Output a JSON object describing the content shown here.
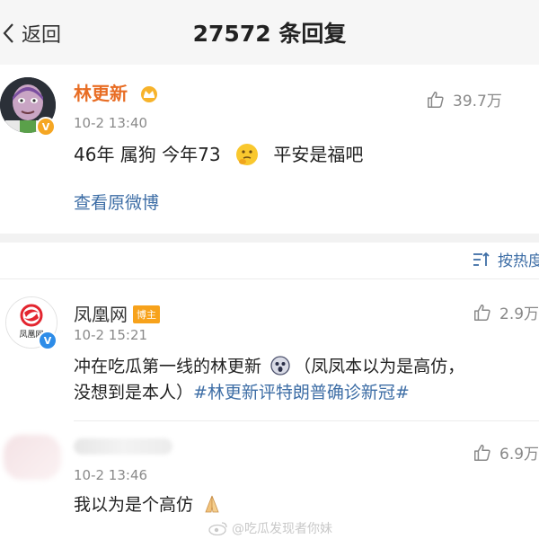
{
  "nav": {
    "back_label": "返回",
    "title_count": "27572",
    "title_suffix": " 条回复"
  },
  "original_post": {
    "author": "林更新",
    "time": "10-2 13:40",
    "likes": "39.7万",
    "text": "46年 属狗 今年73",
    "text_after_emoji": "平安是福吧",
    "view_original": "查看原微博"
  },
  "sort": {
    "label": "按热度"
  },
  "replies": [
    {
      "author": "凤凰网",
      "badge": "博主",
      "time": "10-2 15:21",
      "likes": "2.9万",
      "text": "冲在吃瓜第一线的林更新",
      "text_after_emoji": "（凤凤本以为是高仿，",
      "text_line2": "没想到是本人）",
      "hashtag": "#林更新评特朗普确诊新冠#",
      "avatar_text": "凤凰网"
    },
    {
      "time": "10-2 13:46",
      "likes": "6.9万",
      "text": "我以为是个高仿"
    }
  ],
  "watermark": "@吃瓜发现者你妹",
  "colors": {
    "link": "#3e6ea6",
    "author_orange": "#e86d24",
    "topbar_bg": "#f6f6f6",
    "gap_bg": "#f2f2f2"
  }
}
